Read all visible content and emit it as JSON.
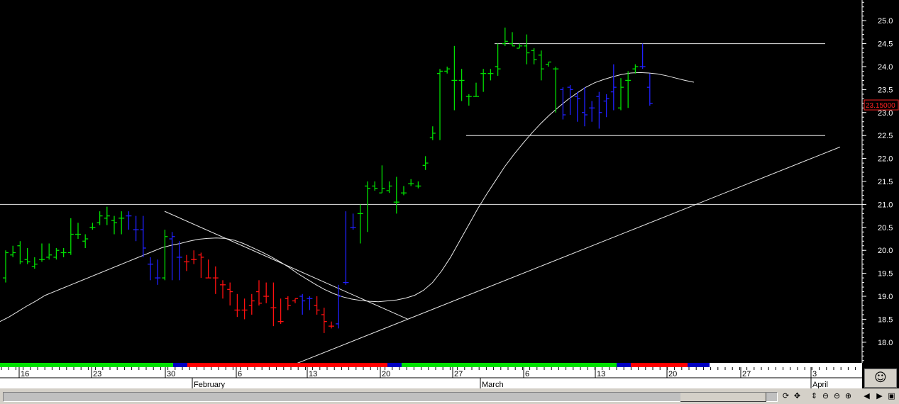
{
  "chart_data": {
    "type": "ohlc",
    "y_axis": {
      "ticks": [
        "18.0",
        "18.5",
        "19.0",
        "19.5",
        "20.0",
        "20.5",
        "21.0",
        "21.5",
        "22.0",
        "22.5",
        "23.0",
        "23.5",
        "24.0",
        "24.5",
        "25.0"
      ],
      "range": [
        17.55,
        25.45
      ]
    },
    "last_price_label": "23.15000",
    "x_axis": {
      "day_labels": [
        "16",
        "23",
        "30",
        "6",
        "13",
        "20",
        "27",
        "6",
        "13",
        "20",
        "27",
        "3"
      ],
      "month_labels": [
        "February",
        "March",
        "April"
      ]
    },
    "horizontal_lines": [
      24.5,
      22.5,
      21.0
    ],
    "trend_lines": [
      {
        "from": [
          "2024-01-31",
          20.85
        ],
        "to": [
          "2024-02-21",
          18.5
        ]
      },
      {
        "from": [
          "2024-02-09",
          17.5
        ],
        "to": [
          "2024-03-26",
          22.25
        ]
      }
    ],
    "bars": [
      {
        "c": "green",
        "o": 19.4,
        "h": 20.0,
        "l": 19.3,
        "cl": 19.95
      },
      {
        "c": "green",
        "o": 19.9,
        "h": 20.1,
        "l": 19.85,
        "cl": 19.95
      },
      {
        "c": "green",
        "o": 20.1,
        "h": 20.2,
        "l": 19.7,
        "cl": 19.75
      },
      {
        "c": "green",
        "o": 19.8,
        "h": 20.05,
        "l": 19.7,
        "cl": 19.75
      },
      {
        "c": "green",
        "o": 19.65,
        "h": 19.85,
        "l": 19.6,
        "cl": 19.7
      },
      {
        "c": "green",
        "o": 19.8,
        "h": 20.15,
        "l": 19.75,
        "cl": 19.8
      },
      {
        "c": "green",
        "o": 19.85,
        "h": 20.15,
        "l": 19.8,
        "cl": 19.9
      },
      {
        "c": "green",
        "o": 19.85,
        "h": 20.05,
        "l": 19.8,
        "cl": 20.0
      },
      {
        "c": "green",
        "o": 19.95,
        "h": 20.05,
        "l": 19.85,
        "cl": 19.95
      },
      {
        "c": "green",
        "o": 19.95,
        "h": 20.7,
        "l": 19.9,
        "cl": 20.35
      },
      {
        "c": "green",
        "o": 20.35,
        "h": 20.6,
        "l": 20.25,
        "cl": 20.35
      },
      {
        "c": "green",
        "o": 20.2,
        "h": 20.35,
        "l": 20.05,
        "cl": 20.25
      },
      {
        "c": "green",
        "o": 20.5,
        "h": 20.6,
        "l": 20.45,
        "cl": 20.5
      },
      {
        "c": "green",
        "o": 20.6,
        "h": 20.85,
        "l": 20.55,
        "cl": 20.75
      },
      {
        "c": "green",
        "o": 20.7,
        "h": 20.95,
        "l": 20.55,
        "cl": 20.75
      },
      {
        "c": "green",
        "o": 20.65,
        "h": 20.75,
        "l": 20.35,
        "cl": 20.6
      },
      {
        "c": "green",
        "o": 20.7,
        "h": 20.85,
        "l": 20.35,
        "cl": 20.7
      },
      {
        "c": "blue",
        "o": 20.75,
        "h": 20.85,
        "l": 20.45,
        "cl": 20.75
      },
      {
        "c": "blue",
        "o": 20.45,
        "h": 20.75,
        "l": 20.2,
        "cl": 20.45
      },
      {
        "c": "blue",
        "o": 20.45,
        "h": 20.75,
        "l": 19.85,
        "cl": 20.05
      },
      {
        "c": "blue",
        "o": 19.7,
        "h": 19.85,
        "l": 19.35,
        "cl": 19.7
      },
      {
        "c": "blue",
        "o": 19.4,
        "h": 19.8,
        "l": 19.25,
        "cl": 19.4
      },
      {
        "c": "green",
        "o": 19.4,
        "h": 20.45,
        "l": 19.35,
        "cl": 20.3
      },
      {
        "c": "blue",
        "o": 20.25,
        "h": 20.4,
        "l": 19.35,
        "cl": 20.3
      },
      {
        "c": "blue",
        "o": 19.85,
        "h": 20.2,
        "l": 19.35,
        "cl": 19.85
      },
      {
        "c": "red",
        "o": 19.75,
        "h": 19.9,
        "l": 19.55,
        "cl": 19.75
      },
      {
        "c": "red",
        "o": 19.8,
        "h": 20.0,
        "l": 19.7,
        "cl": 19.8
      },
      {
        "c": "red",
        "o": 19.9,
        "h": 19.95,
        "l": 19.4,
        "cl": 19.85
      },
      {
        "c": "red",
        "o": 19.4,
        "h": 19.8,
        "l": 19.4,
        "cl": 19.4
      },
      {
        "c": "red",
        "o": 19.4,
        "h": 19.65,
        "l": 19.05,
        "cl": 19.4
      },
      {
        "c": "red",
        "o": 19.25,
        "h": 19.35,
        "l": 18.95,
        "cl": 19.25
      },
      {
        "c": "red",
        "o": 19.15,
        "h": 19.3,
        "l": 18.8,
        "cl": 19.1
      },
      {
        "c": "red",
        "o": 18.7,
        "h": 19.05,
        "l": 18.55,
        "cl": 18.7
      },
      {
        "c": "red",
        "o": 18.7,
        "h": 18.95,
        "l": 18.5,
        "cl": 18.7
      },
      {
        "c": "red",
        "o": 18.8,
        "h": 19.05,
        "l": 18.6,
        "cl": 18.9
      },
      {
        "c": "red",
        "o": 19.1,
        "h": 19.35,
        "l": 18.8,
        "cl": 18.85
      },
      {
        "c": "red",
        "o": 19.0,
        "h": 19.3,
        "l": 18.85,
        "cl": 19.0
      },
      {
        "c": "red",
        "o": 18.75,
        "h": 19.3,
        "l": 18.35,
        "cl": 18.75
      },
      {
        "c": "red",
        "o": 18.45,
        "h": 18.95,
        "l": 18.4,
        "cl": 18.45
      },
      {
        "c": "red",
        "o": 18.95,
        "h": 19.0,
        "l": 18.7,
        "cl": 18.8
      },
      {
        "c": "red",
        "o": 18.9,
        "h": 18.95,
        "l": 18.85,
        "cl": 18.95
      },
      {
        "c": "blue",
        "o": 19.0,
        "h": 19.05,
        "l": 18.6,
        "cl": 18.9
      },
      {
        "c": "blue",
        "o": 18.95,
        "h": 19.0,
        "l": 18.7,
        "cl": 18.95
      },
      {
        "c": "red",
        "o": 18.8,
        "h": 19.0,
        "l": 18.6,
        "cl": 18.7
      },
      {
        "c": "red",
        "o": 18.6,
        "h": 18.75,
        "l": 18.2,
        "cl": 18.45
      },
      {
        "c": "red",
        "o": 18.35,
        "h": 18.45,
        "l": 18.3,
        "cl": 18.35
      },
      {
        "c": "blue",
        "o": 18.4,
        "h": 19.25,
        "l": 18.3,
        "cl": 19.0
      },
      {
        "c": "blue",
        "o": 19.3,
        "h": 20.85,
        "l": 19.25,
        "cl": 19.3
      },
      {
        "c": "blue",
        "o": 20.5,
        "h": 20.8,
        "l": 20.45,
        "cl": 20.5
      },
      {
        "c": "green",
        "o": 20.8,
        "h": 21.0,
        "l": 20.15,
        "cl": 20.8
      },
      {
        "c": "green",
        "o": 21.4,
        "h": 21.5,
        "l": 20.4,
        "cl": 21.35
      },
      {
        "c": "green",
        "o": 21.4,
        "h": 21.5,
        "l": 21.3,
        "cl": 21.35
      },
      {
        "c": "green",
        "o": 21.25,
        "h": 21.85,
        "l": 21.25,
        "cl": 21.35
      },
      {
        "c": "green",
        "o": 21.3,
        "h": 21.5,
        "l": 21.25,
        "cl": 21.4
      },
      {
        "c": "green",
        "o": 21.05,
        "h": 21.6,
        "l": 20.8,
        "cl": 21.05
      },
      {
        "c": "green",
        "o": 21.25,
        "h": 21.4,
        "l": 21.2,
        "cl": 21.25
      },
      {
        "c": "green",
        "o": 21.45,
        "h": 21.55,
        "l": 21.4,
        "cl": 21.45
      },
      {
        "c": "green",
        "o": 21.4,
        "h": 21.5,
        "l": 21.35,
        "cl": 21.4
      },
      {
        "c": "green",
        "o": 21.85,
        "h": 22.05,
        "l": 21.75,
        "cl": 21.9
      },
      {
        "c": "green",
        "o": 22.45,
        "h": 22.7,
        "l": 22.4,
        "cl": 22.55
      },
      {
        "c": "green",
        "o": 23.85,
        "h": 23.95,
        "l": 22.4,
        "cl": 23.9
      },
      {
        "c": "green",
        "o": 23.9,
        "h": 24.0,
        "l": 23.85,
        "cl": 23.95
      },
      {
        "c": "green",
        "o": 23.7,
        "h": 24.45,
        "l": 23.05,
        "cl": 23.7
      },
      {
        "c": "green",
        "o": 23.7,
        "h": 23.95,
        "l": 23.25,
        "cl": 23.7
      },
      {
        "c": "green",
        "o": 23.35,
        "h": 23.4,
        "l": 23.15,
        "cl": 23.35
      },
      {
        "c": "green",
        "o": 23.35,
        "h": 23.65,
        "l": 23.35,
        "cl": 23.35
      },
      {
        "c": "green",
        "o": 23.85,
        "h": 23.95,
        "l": 23.45,
        "cl": 23.85
      },
      {
        "c": "green",
        "o": 23.85,
        "h": 23.95,
        "l": 23.7,
        "cl": 23.85
      },
      {
        "c": "green",
        "o": 24.0,
        "h": 24.5,
        "l": 23.8,
        "cl": 23.95
      },
      {
        "c": "green",
        "o": 24.5,
        "h": 24.85,
        "l": 24.45,
        "cl": 24.55
      },
      {
        "c": "green",
        "o": 24.5,
        "h": 24.75,
        "l": 24.45,
        "cl": 24.45
      },
      {
        "c": "green",
        "o": 24.4,
        "h": 24.5,
        "l": 24.4,
        "cl": 24.45
      },
      {
        "c": "green",
        "o": 24.45,
        "h": 24.7,
        "l": 24.05,
        "cl": 24.3
      },
      {
        "c": "green",
        "o": 24.35,
        "h": 24.4,
        "l": 24.05,
        "cl": 24.15
      },
      {
        "c": "green",
        "o": 24.25,
        "h": 24.35,
        "l": 23.7,
        "cl": 23.95
      },
      {
        "c": "green",
        "o": 24.05,
        "h": 24.1,
        "l": 24.0,
        "cl": 24.1
      },
      {
        "c": "green",
        "o": 23.95,
        "h": 24.0,
        "l": 23.0,
        "cl": 23.95
      },
      {
        "c": "blue",
        "o": 23.5,
        "h": 23.55,
        "l": 22.85,
        "cl": 22.95
      },
      {
        "c": "blue",
        "o": 23.55,
        "h": 23.6,
        "l": 22.95,
        "cl": 23.5
      },
      {
        "c": "blue",
        "o": 23.35,
        "h": 23.45,
        "l": 22.8,
        "cl": 23.3
      },
      {
        "c": "blue",
        "o": 23.0,
        "h": 23.55,
        "l": 22.7,
        "cl": 22.95
      },
      {
        "c": "blue",
        "o": 23.1,
        "h": 23.25,
        "l": 22.8,
        "cl": 23.1
      },
      {
        "c": "blue",
        "o": 23.35,
        "h": 23.45,
        "l": 22.65,
        "cl": 23.0
      },
      {
        "c": "blue",
        "o": 23.25,
        "h": 23.4,
        "l": 22.9,
        "cl": 23.3
      },
      {
        "c": "blue",
        "o": 23.45,
        "h": 24.05,
        "l": 23.05,
        "cl": 23.55
      },
      {
        "c": "green",
        "o": 23.1,
        "h": 23.75,
        "l": 23.05,
        "cl": 23.55
      },
      {
        "c": "green",
        "o": 23.7,
        "h": 23.9,
        "l": 23.1,
        "cl": 23.7
      },
      {
        "c": "green",
        "o": 23.95,
        "h": 24.05,
        "l": 23.85,
        "cl": 24.0
      },
      {
        "c": "blue",
        "o": 24.0,
        "h": 24.5,
        "l": 23.95,
        "cl": 24.0
      },
      {
        "c": "blue",
        "o": 23.55,
        "h": 23.85,
        "l": 23.15,
        "cl": 23.2
      }
    ],
    "moving_average": [
      [
        0,
        18.45
      ],
      [
        1,
        18.55
      ],
      [
        2,
        18.67
      ],
      [
        3,
        18.79
      ],
      [
        4,
        18.9
      ],
      [
        5,
        19.02
      ],
      [
        6,
        19.1
      ],
      [
        7,
        19.18
      ],
      [
        8,
        19.26
      ],
      [
        9,
        19.34
      ],
      [
        10,
        19.42
      ],
      [
        11,
        19.5
      ],
      [
        12,
        19.58
      ],
      [
        13,
        19.66
      ],
      [
        14,
        19.74
      ],
      [
        15,
        19.82
      ],
      [
        16,
        19.9
      ],
      [
        17,
        19.98
      ],
      [
        18,
        20.06
      ],
      [
        19,
        20.11
      ],
      [
        20,
        20.15
      ],
      [
        21,
        20.2
      ],
      [
        22,
        20.24
      ],
      [
        23,
        20.26
      ],
      [
        24,
        20.27
      ],
      [
        25,
        20.26
      ],
      [
        26,
        20.22
      ],
      [
        27,
        20.15
      ],
      [
        28,
        20.06
      ],
      [
        29,
        19.97
      ],
      [
        30,
        19.87
      ],
      [
        31,
        19.76
      ],
      [
        32,
        19.64
      ],
      [
        33,
        19.5
      ],
      [
        34,
        19.38
      ],
      [
        35,
        19.26
      ],
      [
        36,
        19.15
      ],
      [
        37,
        19.06
      ],
      [
        38,
        18.99
      ],
      [
        39,
        18.94
      ],
      [
        40,
        18.91
      ],
      [
        41,
        18.89
      ],
      [
        42,
        18.88
      ],
      [
        43,
        18.9
      ],
      [
        44,
        18.92
      ],
      [
        45,
        18.96
      ],
      [
        46,
        19.02
      ],
      [
        47,
        19.13
      ],
      [
        48,
        19.3
      ],
      [
        49,
        19.55
      ],
      [
        50,
        19.85
      ],
      [
        51,
        20.2
      ],
      [
        52,
        20.55
      ],
      [
        53,
        20.9
      ],
      [
        54,
        21.22
      ],
      [
        55,
        21.52
      ],
      [
        56,
        21.82
      ],
      [
        57,
        22.08
      ],
      [
        58,
        22.32
      ],
      [
        59,
        22.55
      ],
      [
        60,
        22.76
      ],
      [
        61,
        22.95
      ],
      [
        62,
        23.12
      ],
      [
        63,
        23.28
      ],
      [
        64,
        23.42
      ],
      [
        65,
        23.55
      ],
      [
        66,
        23.65
      ],
      [
        67,
        23.72
      ],
      [
        68,
        23.78
      ],
      [
        69,
        23.83
      ],
      [
        70,
        23.86
      ],
      [
        71,
        23.87
      ],
      [
        72,
        23.86
      ],
      [
        73,
        23.84
      ],
      [
        74,
        23.8
      ],
      [
        75,
        23.75
      ],
      [
        76,
        23.7
      ],
      [
        77,
        23.66
      ]
    ],
    "strip": [
      {
        "color": "#00e000",
        "w": 244
      },
      {
        "color": "#0000c0",
        "w": 20
      },
      {
        "color": "#ff0000",
        "w": 282
      },
      {
        "color": "#0000c0",
        "w": 20
      },
      {
        "color": "#00e000",
        "w": 303
      },
      {
        "color": "#0000c0",
        "w": 20
      },
      {
        "color": "#ff0000",
        "w": 80
      },
      {
        "color": "#0000c0",
        "w": 31
      }
    ],
    "colors": {
      "green": "#00e000",
      "blue": "#2020ff",
      "red": "#ff1010",
      "axis": "#ffffff",
      "line": "#e8e8e8",
      "last_label": "#ff2020"
    }
  },
  "toolbar": {
    "icons": [
      "refresh-icon",
      "move-icon",
      "scroll-updown-icon",
      "zoom-fit-icon",
      "zoom-out-icon",
      "zoom-in-icon",
      "scroll-left-icon",
      "scroll-right-icon",
      "window-icon"
    ],
    "glyphs": [
      "⟳",
      "✥",
      "⇕",
      "⊖",
      "⊖",
      "⊕",
      "◀",
      "▶",
      "▣"
    ]
  },
  "status_face": "☺"
}
